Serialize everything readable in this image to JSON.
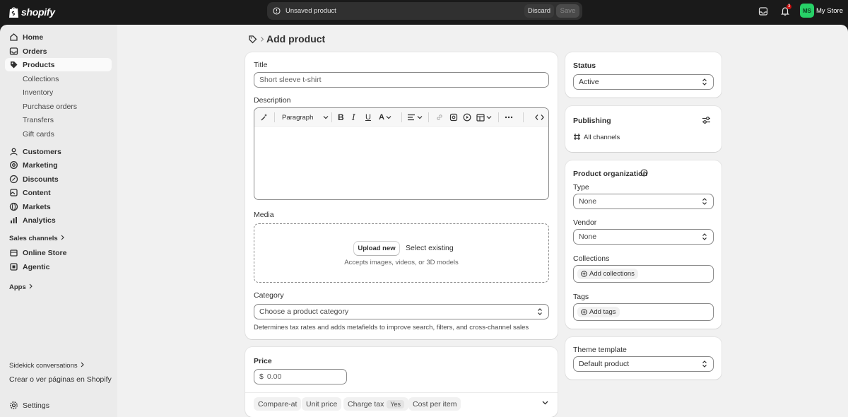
{
  "topbar": {
    "logo_text": "shopify",
    "unsaved_text": "Unsaved product",
    "discard_label": "Discard",
    "save_label": "Save",
    "notification_count": "3",
    "avatar_initials": "MS",
    "store_name": "My Store"
  },
  "sidebar": {
    "main_items": [
      {
        "label": "Home",
        "icon": "home-icon"
      },
      {
        "label": "Orders",
        "icon": "inbox-icon"
      },
      {
        "label": "Products",
        "icon": "tag-icon"
      }
    ],
    "product_subitems": [
      "Collections",
      "Inventory",
      "Purchase orders",
      "Transfers",
      "Gift cards"
    ],
    "more_items": [
      {
        "label": "Customers",
        "icon": "person-icon"
      },
      {
        "label": "Marketing",
        "icon": "target-icon"
      },
      {
        "label": "Discounts",
        "icon": "discount-icon"
      },
      {
        "label": "Content",
        "icon": "content-icon"
      },
      {
        "label": "Markets",
        "icon": "globe-icon"
      },
      {
        "label": "Analytics",
        "icon": "chart-icon"
      }
    ],
    "sales_channels_label": "Sales channels",
    "channel_items": [
      {
        "label": "Online Store",
        "icon": "store-icon"
      },
      {
        "label": "Agentic",
        "icon": "agentic-icon"
      }
    ],
    "apps_label": "Apps",
    "sidekick_label": "Sidekick conversations",
    "sidekick_item": "Crear o ver páginas en Shopify",
    "settings_label": "Settings"
  },
  "page": {
    "title": "Add product"
  },
  "product_card": {
    "title_label": "Title",
    "title_placeholder": "Short sleeve t-shirt",
    "description_label": "Description",
    "paragraph_label": "Paragraph",
    "media_label": "Media",
    "upload_label": "Upload new",
    "select_existing_label": "Select existing",
    "media_hint": "Accepts images, videos, or 3D models",
    "category_label": "Category",
    "category_placeholder": "Choose a product category",
    "category_hint": "Determines tax rates and adds metafields to improve search, filters, and cross-channel sales"
  },
  "price_card": {
    "price_label": "Price",
    "currency_symbol": "$",
    "price_placeholder": "0.00",
    "compare_at_label": "Compare-at",
    "unit_price_label": "Unit price",
    "charge_tax_label": "Charge tax",
    "charge_tax_value": "Yes",
    "cost_per_item_label": "Cost per item"
  },
  "status_card": {
    "label": "Status",
    "value": "Active"
  },
  "publishing_card": {
    "label": "Publishing",
    "channels_label": "All channels"
  },
  "organization_card": {
    "label": "Product organization",
    "type_label": "Type",
    "type_value": "None",
    "vendor_label": "Vendor",
    "vendor_value": "None",
    "collections_label": "Collections",
    "add_collections_label": "Add collections",
    "tags_label": "Tags",
    "add_tags_label": "Add tags"
  },
  "theme_card": {
    "label": "Theme template",
    "value": "Default product"
  },
  "colors": {
    "topbar_bg": "#1a1a1a",
    "sidebar_bg": "#ebebeb",
    "main_bg": "#f1f1f1",
    "avatar_bg": "#27d067"
  }
}
